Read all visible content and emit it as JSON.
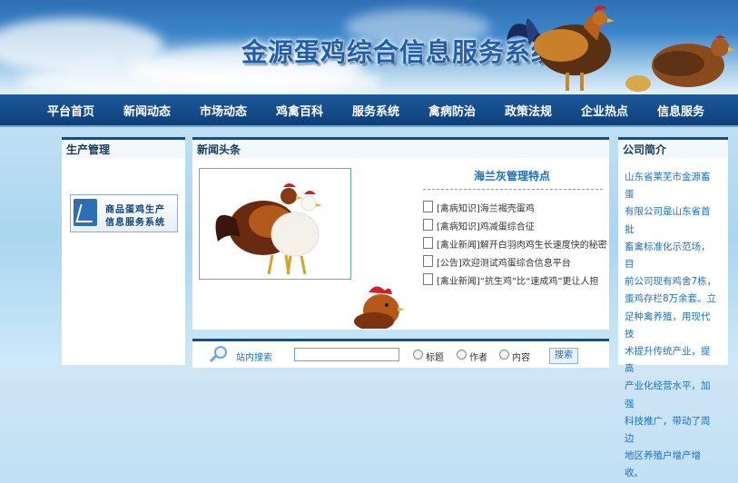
{
  "header": {
    "title": "金源蛋鸡综合信息服务系统"
  },
  "nav": {
    "items": [
      "平台首页",
      "新闻动态",
      "市场动态",
      "鸡禽百科",
      "服务系统",
      "禽病防治",
      "政策法规",
      "企业热点",
      "信息服务"
    ]
  },
  "left_panel": {
    "title": "生产管理",
    "banner_line1": "商品蛋鸡生产",
    "banner_line2": "信息服务系统"
  },
  "news_panel": {
    "title": "新闻头条",
    "feature_title": "海兰灰管理特点",
    "items": [
      "[禽病知识]海兰褐壳蛋鸡",
      "[禽病知识]鸡减蛋综合征",
      "[禽业新闻]解开白羽肉鸡生长速度快的秘密",
      "[公告]欢迎测试鸡蛋综合信息平台",
      "[禽业新闻]“抗生鸡”比“速成鸡”更让人担"
    ]
  },
  "about_panel": {
    "title": "公司简介",
    "lines": [
      "山东省莱芜市金源畜蛋",
      "有限公司是山东省首批",
      "畜禽标准化示范场，目",
      "前公司现有鸡舍7栋，",
      "蛋鸡存栏8万余套。立",
      "足种禽养殖，用现代技",
      "术提升传统产业，提高",
      "产业化经营水平，加强",
      "科技推广，带动了周边",
      "地区养殖户增产增收。"
    ]
  },
  "search": {
    "label": "站内搜索",
    "value": "",
    "options": [
      "标题",
      "作者",
      "内容"
    ],
    "button": "搜索"
  },
  "colors": {
    "nav_bg": "#0d3f79",
    "accent": "#1d6fc1",
    "panel_border": "#0d4f97"
  },
  "icons": [
    "search-icon",
    "document-icon",
    "chart-icon"
  ]
}
